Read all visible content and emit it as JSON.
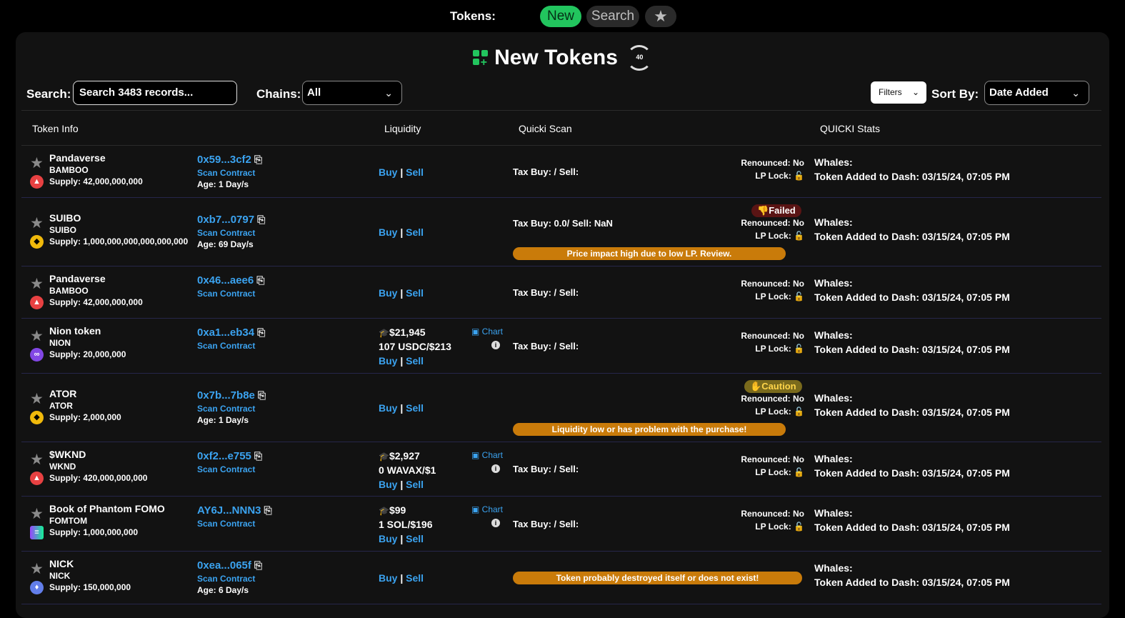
{
  "topbar": {
    "label": "Tokens:",
    "new": "New",
    "search": "Search",
    "favorites_icon": "star-icon"
  },
  "title": "New Tokens",
  "refresh_count": "40",
  "controls": {
    "search_label": "Search:",
    "search_placeholder": "Search 3483 records...",
    "chains_label": "Chains:",
    "chains_value": "All",
    "filters": "Filters",
    "sortby_label": "Sort By:",
    "sortby_value": "Date Added"
  },
  "headers": {
    "token_info": "Token Info",
    "liquidity": "Liquidity",
    "quicki_scan": "Quicki Scan",
    "quicki_stats": "QUICKI Stats"
  },
  "common": {
    "scan_contract": "Scan Contract",
    "buy": "Buy",
    "sep": "|",
    "sell": "Sell",
    "chart": "Chart",
    "renounced": "Renounced: No",
    "lp_lock": "LP Lock:",
    "whales": "Whales:",
    "added": "Token Added to Dash: 03/15/24, 07:05 PM"
  },
  "rows": [
    {
      "name": "Pandaverse",
      "symbol": "BAMBOO",
      "supply": "Supply: 42,000,000,000",
      "chain": "avax",
      "address": "0x59...3cf2",
      "age": "Age: 1 Day/s",
      "tax": "Tax Buy: / Sell:"
    },
    {
      "name": "SUIBO",
      "symbol": "SUIBO",
      "supply": "Supply: 1,000,000,000,000,000,000",
      "chain": "bsc",
      "address": "0xb7...0797",
      "age": "Age: 69 Day/s",
      "tax": "Tax Buy: 0.0/ Sell: NaN",
      "badge": "Failed",
      "warning": "Price impact high due to low LP. Review."
    },
    {
      "name": "Pandaverse",
      "symbol": "BAMBOO",
      "supply": "Supply: 42,000,000,000",
      "chain": "avax",
      "address": "0x46...aee6",
      "tax": "Tax Buy: / Sell:"
    },
    {
      "name": "Nion token",
      "symbol": "NION",
      "supply": "Supply: 20,000,000",
      "chain": "polygon",
      "address": "0xa1...eb34",
      "tax": "Tax Buy: / Sell:",
      "liq_cap": "$21,945",
      "liq_pair": "107 USDC/$213"
    },
    {
      "name": "ATOR",
      "symbol": "ATOR",
      "supply": "Supply: 2,000,000",
      "chain": "bsc",
      "address": "0x7b...7b8e",
      "age": "Age: 1 Day/s",
      "badge": "Caution",
      "warning": "Liquidity low or has problem with the purchase!"
    },
    {
      "name": "$WKND",
      "symbol": "WKND",
      "supply": "Supply: 420,000,000,000",
      "chain": "avax",
      "address": "0xf2...e755",
      "tax": "Tax Buy: / Sell:",
      "liq_cap": "$2,927",
      "liq_pair": "0 WAVAX/$1"
    },
    {
      "name": "Book of Phantom FOMO",
      "symbol": "FOMTOM",
      "supply": "Supply: 1,000,000,000",
      "chain": "solana",
      "address": "AY6J...NNN3",
      "tax": "Tax Buy: / Sell:",
      "liq_cap": "$99",
      "liq_pair": "1 SOL/$196"
    },
    {
      "name": "NICK",
      "symbol": "NICK",
      "supply": "Supply: 150,000,000",
      "chain": "eth",
      "address": "0xea...065f",
      "age": "Age: 6 Day/s",
      "warning": "Token probably destroyed itself or does not exist!"
    }
  ]
}
